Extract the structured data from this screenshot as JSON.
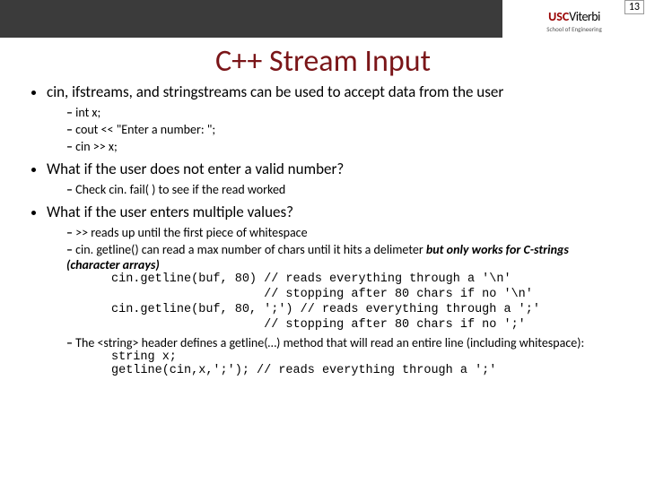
{
  "page_number": "13",
  "logo": {
    "usc": "USC",
    "viterbi": "Viterbi",
    "sub": "School of Engineering"
  },
  "title": "C++ Stream Input",
  "b1": {
    "text": "cin, ifstreams, and stringstreams can be used to accept data from the user",
    "s1": "int x;",
    "s2": "cout << \"Enter a number: \";",
    "s3": "cin >> x;"
  },
  "b2": {
    "text": "What if the user does not enter a valid number?",
    "s1": "Check cin. fail( ) to see if the read worked"
  },
  "b3": {
    "text": "What if the user enters multiple values?",
    "s1": ">> reads up until the first piece of whitespace",
    "s2a": "cin. getline() can read a max number of chars until it hits a delimeter ",
    "s2b": "but only works for C-strings (character arrays)",
    "code1a": "cin.getline(buf, 80) // reads everything through a '\\n'",
    "code1b": "                     // stopping after 80 chars if no '\\n'",
    "code1c": "cin.getline(buf, 80, ';') // reads everything through a ';'",
    "code1d": "                     // stopping after 80 chars if no ';'",
    "s3": "The <string> header defines a getline(…) method that will read an entire line (including whitespace):",
    "code2a": "string x;",
    "code2b": "getline(cin,x,';'); // reads everything through a ';'"
  }
}
